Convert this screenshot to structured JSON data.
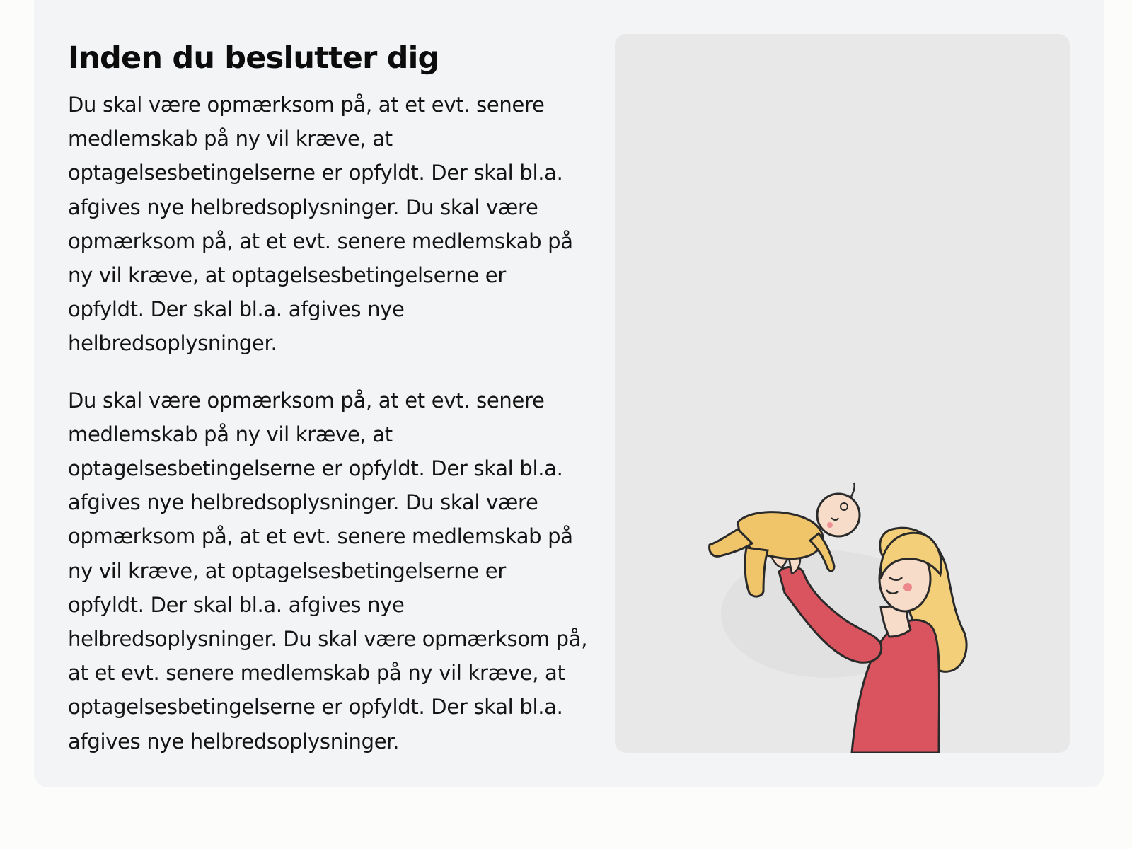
{
  "section": {
    "heading": "Inden du beslutter dig",
    "paragraphs": [
      "Du skal være opmærksom på, at et evt. senere medlemskab på ny vil kræve, at optagelsesbetingelserne er opfyldt. Der skal bl.a. afgives nye helbredsoplysninger. Du skal være opmærksom på, at et evt. senere medlemskab på ny vil kræve, at optagelsesbetingelserne er opfyldt. Der skal bl.a. afgives nye helbredsoplysninger.",
      "Du skal være opmærksom på, at et evt. senere medlemskab på ny vil kræve, at optagelsesbetingelserne er opfyldt. Der skal bl.a. afgives nye helbredsoplysninger. Du skal være opmærksom på, at et evt. senere medlemskab på ny vil kræve, at optagelsesbetingelserne er opfyldt. Der skal bl.a. afgives nye helbredsoplysninger. Du skal være opmærksom på, at et evt. senere medlemskab på ny vil kræve, at optagelsesbetingelserne er opfyldt. Der skal bl.a. afgives nye helbredsoplysninger."
    ]
  },
  "illustration": {
    "icon": "mother-lifting-baby-illustration"
  },
  "colors": {
    "page_background": "#fcfcfb",
    "card_background": "#f3f4f5",
    "image_background": "#e8e8e9",
    "text": "#141414",
    "shirt_red": "#d9545f",
    "hair_yellow": "#f3cf7a",
    "babysuit_yellow": "#f0c56a",
    "skin": "#f7dcc9"
  }
}
